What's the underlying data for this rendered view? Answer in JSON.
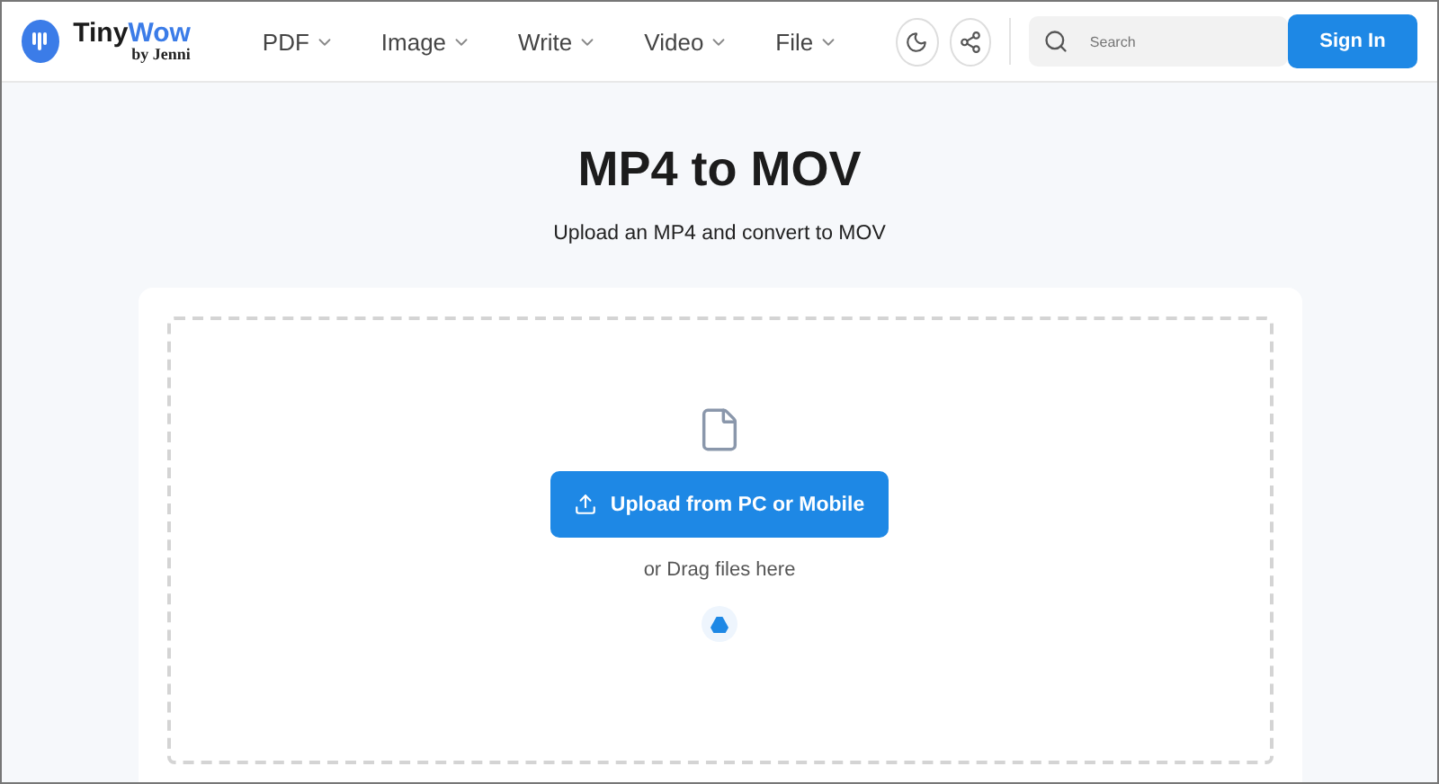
{
  "brand": {
    "name_start": "Tiny",
    "name_end": "Wow",
    "byline": "by Jenni"
  },
  "nav": [
    {
      "label": "PDF"
    },
    {
      "label": "Image"
    },
    {
      "label": "Write"
    },
    {
      "label": "Video"
    },
    {
      "label": "File"
    }
  ],
  "search": {
    "placeholder": "Search"
  },
  "sign_in": "Sign In",
  "title": "MP4 to MOV",
  "subtitle": "Upload an MP4 and convert to MOV",
  "upload_button": "Upload from PC or Mobile",
  "drag_hint": "or Drag files here"
}
